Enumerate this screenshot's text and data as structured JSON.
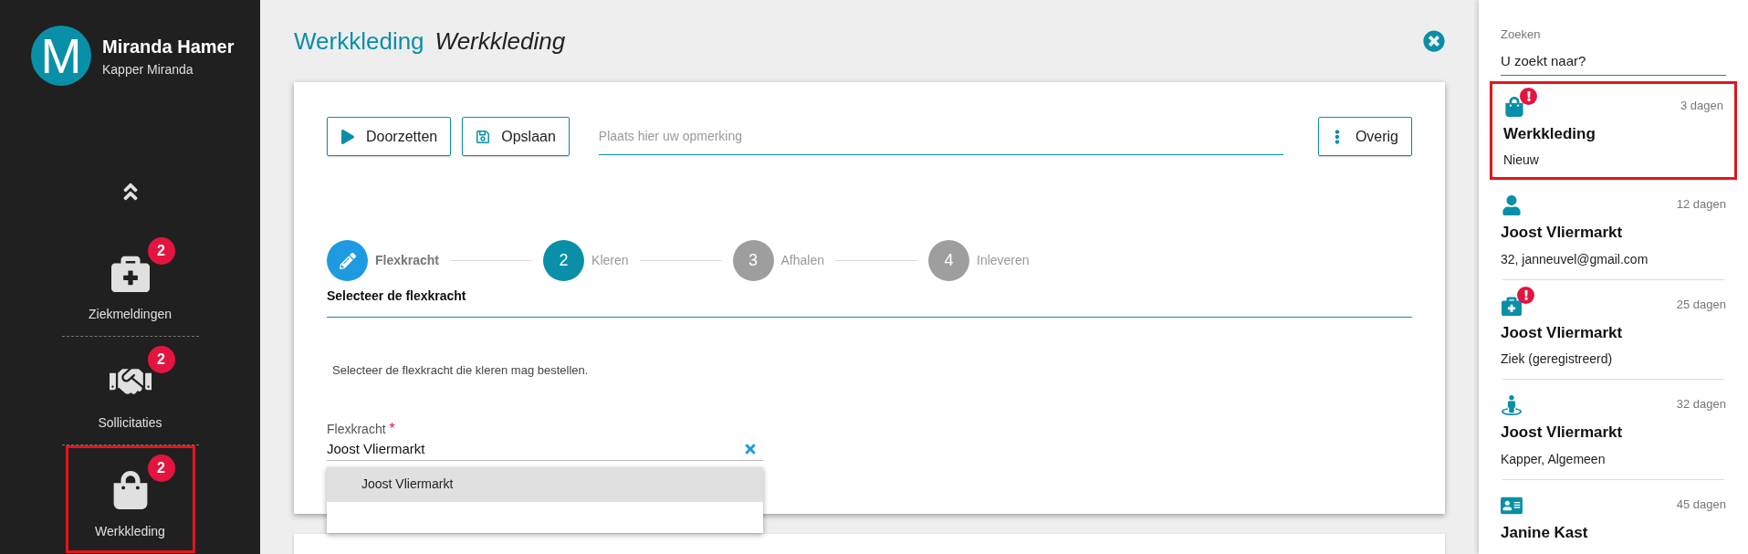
{
  "user": {
    "initial": "M",
    "name": "Miranda Hamer",
    "subtitle": "Kapper Miranda"
  },
  "nav": [
    {
      "kind": "medkit",
      "label": "Ziekmeldingen",
      "badge": "2",
      "highlighted": false
    },
    {
      "kind": "handshake",
      "label": "Sollicitaties",
      "badge": "2",
      "highlighted": false
    },
    {
      "kind": "bag",
      "label": "Werkkleding",
      "badge": "2",
      "highlighted": true
    }
  ],
  "page": {
    "title": "Werkkleding",
    "subtitle": "Werkkleding"
  },
  "toolbar": {
    "buttons": [
      {
        "kind": "play",
        "label": "Doorzetten"
      },
      {
        "kind": "save",
        "label": "Opslaan"
      }
    ],
    "remark": {
      "placeholder": "Plaats hier uw opmerking"
    },
    "more": {
      "label": "Overig"
    }
  },
  "steps": [
    {
      "kind": "done",
      "label": "Flexkracht"
    },
    {
      "kind": "current",
      "number": "2",
      "label": "Kleren"
    },
    {
      "kind": "pending",
      "number": "3",
      "label": "Afhalen"
    },
    {
      "kind": "pending",
      "number": "4",
      "label": "Inleveren"
    }
  ],
  "section": {
    "title": "Selecteer de flexkracht",
    "description": "Selecteer de flexkracht die kleren mag bestellen."
  },
  "field": {
    "label": "Flexkracht",
    "required": true,
    "required_mark": "*",
    "value": "Joost Vliermarkt",
    "options": [
      {
        "label": "Joost Vliermarkt",
        "selected": true
      }
    ]
  },
  "search": {
    "label": "Zoeken",
    "placeholder": "U zoekt naar?"
  },
  "items": [
    {
      "kind": "bag",
      "alert": true,
      "age": "3 dagen",
      "title": "Werkkleding",
      "subtitle": "Nieuw",
      "highlighted": true
    },
    {
      "kind": "person",
      "alert": false,
      "age": "12 dagen",
      "title": "Joost Vliermarkt",
      "subtitle": "32, janneuvel@gmail.com",
      "highlighted": false
    },
    {
      "kind": "medkit",
      "alert": true,
      "age": "25 dagen",
      "title": "Joost Vliermarkt",
      "subtitle": "Ziek (geregistreerd)",
      "highlighted": false
    },
    {
      "kind": "location",
      "alert": false,
      "age": "32 dagen",
      "title": "Joost Vliermarkt",
      "subtitle": "Kapper, Algemeen",
      "highlighted": false
    },
    {
      "kind": "card",
      "alert": false,
      "age": "45 dagen",
      "title": "Janine Kast",
      "highlighted": false
    }
  ]
}
